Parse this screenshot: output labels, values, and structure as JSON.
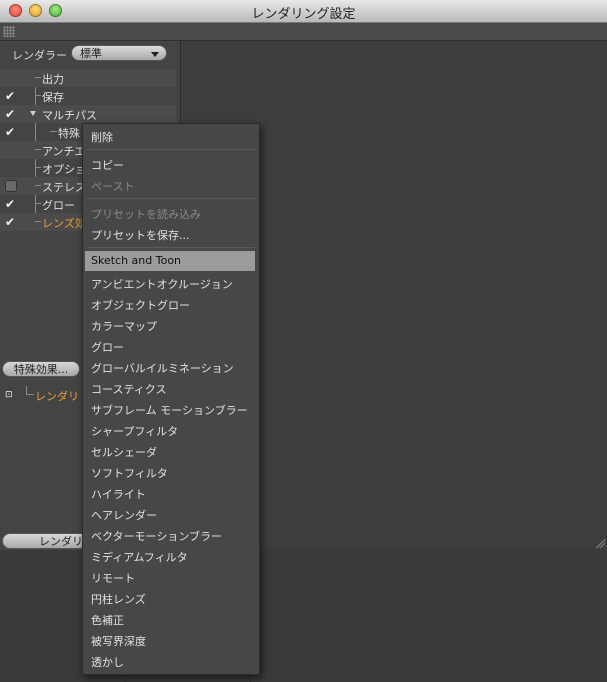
{
  "window": {
    "title": "レンダリング設定"
  },
  "left": {
    "renderer_label": "レンダラー",
    "renderer_value": "標準",
    "tree": [
      {
        "label": "出力",
        "check": "none"
      },
      {
        "label": "保存",
        "check": "checked"
      },
      {
        "label": "マルチパス",
        "check": "checked"
      },
      {
        "label": "特殊",
        "check": "checked"
      },
      {
        "label": "アンチエ",
        "check": "none"
      },
      {
        "label": "オプショ",
        "check": "none"
      },
      {
        "label": "ステレス",
        "check": "unchecked"
      },
      {
        "label": "グロー",
        "check": "checked"
      },
      {
        "label": "レンズ効",
        "check": "checked"
      }
    ],
    "effects_button": "特殊効果...",
    "render_item": "レンダリ",
    "render_button": "レンダリ"
  },
  "menu": {
    "delete": "削除",
    "copy": "コピー",
    "paste": "ペースト",
    "load_preset": "プリセットを読み込み",
    "save_preset": "プリセットを保存...",
    "effects": [
      "Sketch and Toon",
      "アンビエントオクルージョン",
      "オブジェクトグロー",
      "カラーマップ",
      "グロー",
      "グローバルイルミネーション",
      "コースティクス",
      "サブフレーム モーションブラー",
      "シャープフィルタ",
      "セルシェーダ",
      "ソフトフィルタ",
      "ハイライト",
      "ヘアレンダー",
      "ベクターモーションブラー",
      "ミディアムフィルタ",
      "リモート",
      "円柱レンズ",
      "色補正",
      "被写界深度",
      "透かし"
    ],
    "highlighted": "Sketch and Toon"
  }
}
